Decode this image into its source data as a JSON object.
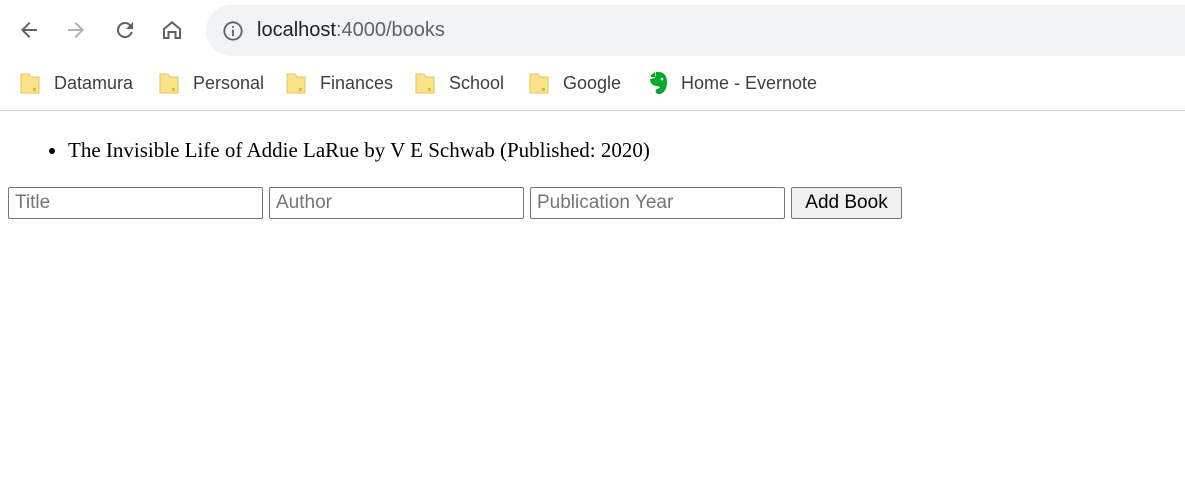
{
  "browser": {
    "url_host": "localhost",
    "url_path": ":4000/books",
    "bookmarks": [
      {
        "label": "Datamura",
        "icon": "folder-icon"
      },
      {
        "label": "Personal",
        "icon": "folder-icon"
      },
      {
        "label": "Finances",
        "icon": "folder-icon"
      },
      {
        "label": "School",
        "icon": "folder-icon"
      },
      {
        "label": "Google",
        "icon": "folder-icon"
      },
      {
        "label": "Home - Evernote",
        "icon": "evernote-icon"
      }
    ]
  },
  "page": {
    "books": [
      {
        "text": "The Invisible Life of Addie LaRue by V E Schwab (Published: 2020)"
      }
    ],
    "form": {
      "title_placeholder": "Title",
      "author_placeholder": "Author",
      "year_placeholder": "Publication Year",
      "submit_label": "Add Book"
    }
  },
  "colors": {
    "folder": "#fce28a",
    "evernote": "#00a82d",
    "omnibox_bg": "#f1f3f4"
  }
}
